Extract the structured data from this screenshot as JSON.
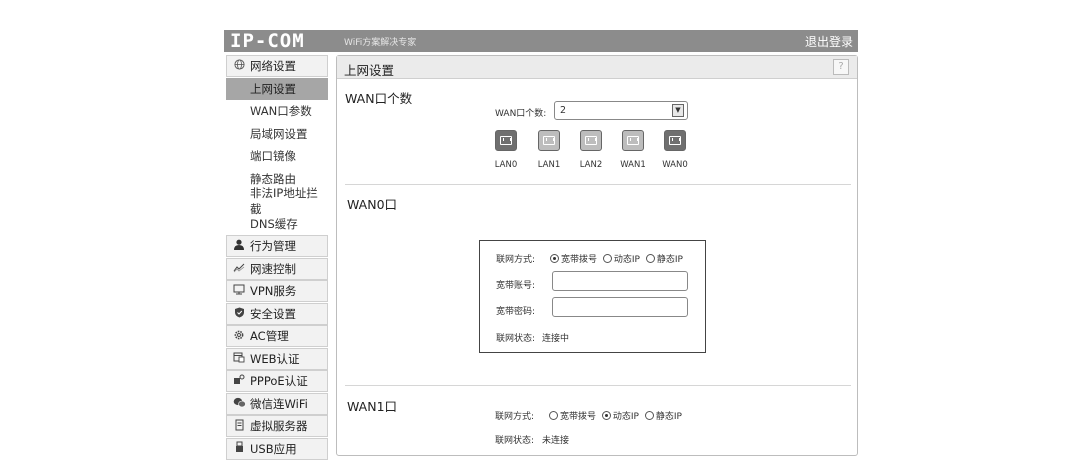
{
  "header": {
    "logo": "IP-COM",
    "tagline": "WiFi方案解决专家",
    "logout": "退出登录"
  },
  "sidebar": {
    "network_group": {
      "label": "网络设置",
      "icon": "globe-icon"
    },
    "network_items": [
      "上网设置",
      "WAN口参数",
      "局域网设置",
      "端口镜像",
      "静态路由",
      "非法IP地址拦截",
      "DNS缓存"
    ],
    "active_item": "上网设置",
    "groups": [
      {
        "label": "行为管理",
        "icon": "user-icon"
      },
      {
        "label": "网速控制",
        "icon": "speed-graph-icon"
      },
      {
        "label": "VPN服务",
        "icon": "vpn-monitor-icon"
      },
      {
        "label": "安全设置",
        "icon": "shield-icon"
      },
      {
        "label": "AC管理",
        "icon": "gear-icon"
      },
      {
        "label": "WEB认证",
        "icon": "web-auth-icon"
      },
      {
        "label": "PPPoE认证",
        "icon": "pppoe-key-icon"
      },
      {
        "label": "微信连WiFi",
        "icon": "wechat-icon"
      },
      {
        "label": "虚拟服务器",
        "icon": "server-icon"
      },
      {
        "label": "USB应用",
        "icon": "usb-icon"
      }
    ]
  },
  "main": {
    "title": "上网设置",
    "help": "?",
    "wan_count_section": {
      "title": "WAN口个数",
      "count_label": "WAN口个数:",
      "count_value": "2",
      "ports": [
        {
          "label": "LAN0",
          "state": "dark"
        },
        {
          "label": "LAN1",
          "state": "light"
        },
        {
          "label": "LAN2",
          "state": "light"
        },
        {
          "label": "WAN1",
          "state": "light"
        },
        {
          "label": "WAN0",
          "state": "dark"
        }
      ]
    },
    "wan0": {
      "title": "WAN0口",
      "mode_label": "联网方式:",
      "modes": [
        "宽带拨号",
        "动态IP",
        "静态IP"
      ],
      "selected_mode": "宽带拨号",
      "account_label": "宽带账号:",
      "account_value": "",
      "password_label": "宽带密码:",
      "password_value": "",
      "status_label": "联网状态:",
      "status_value": "连接中"
    },
    "wan1": {
      "title": "WAN1口",
      "mode_label": "联网方式:",
      "modes": [
        "宽带拨号",
        "动态IP",
        "静态IP"
      ],
      "selected_mode": "动态IP",
      "status_label": "联网状态:",
      "status_value": "未连接"
    }
  }
}
